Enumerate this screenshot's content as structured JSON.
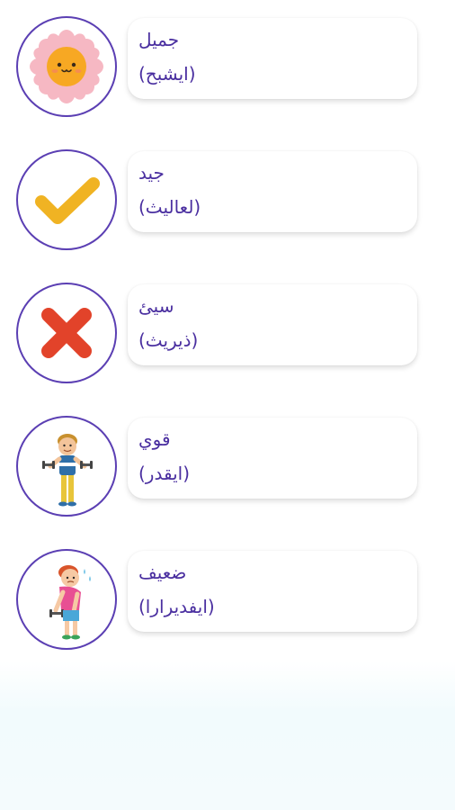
{
  "items": [
    {
      "word": "جميل",
      "transliteration": "(ايشبح)",
      "icon": "sun-flower-icon"
    },
    {
      "word": "جيد",
      "transliteration": "(لعاليث)",
      "icon": "checkmark-icon"
    },
    {
      "word": "سيئ",
      "transliteration": "(ذيريث)",
      "icon": "cross-icon"
    },
    {
      "word": "قوي",
      "transliteration": "(ايقدر)",
      "icon": "strong-boy-icon"
    },
    {
      "word": "ضعيف",
      "transliteration": "(ايفديرارا)",
      "icon": "weak-boy-icon"
    }
  ],
  "colors": {
    "accent": "#5b3fb3",
    "text": "#4a2fa0",
    "check": "#f0b323",
    "cross": "#e2432a"
  }
}
